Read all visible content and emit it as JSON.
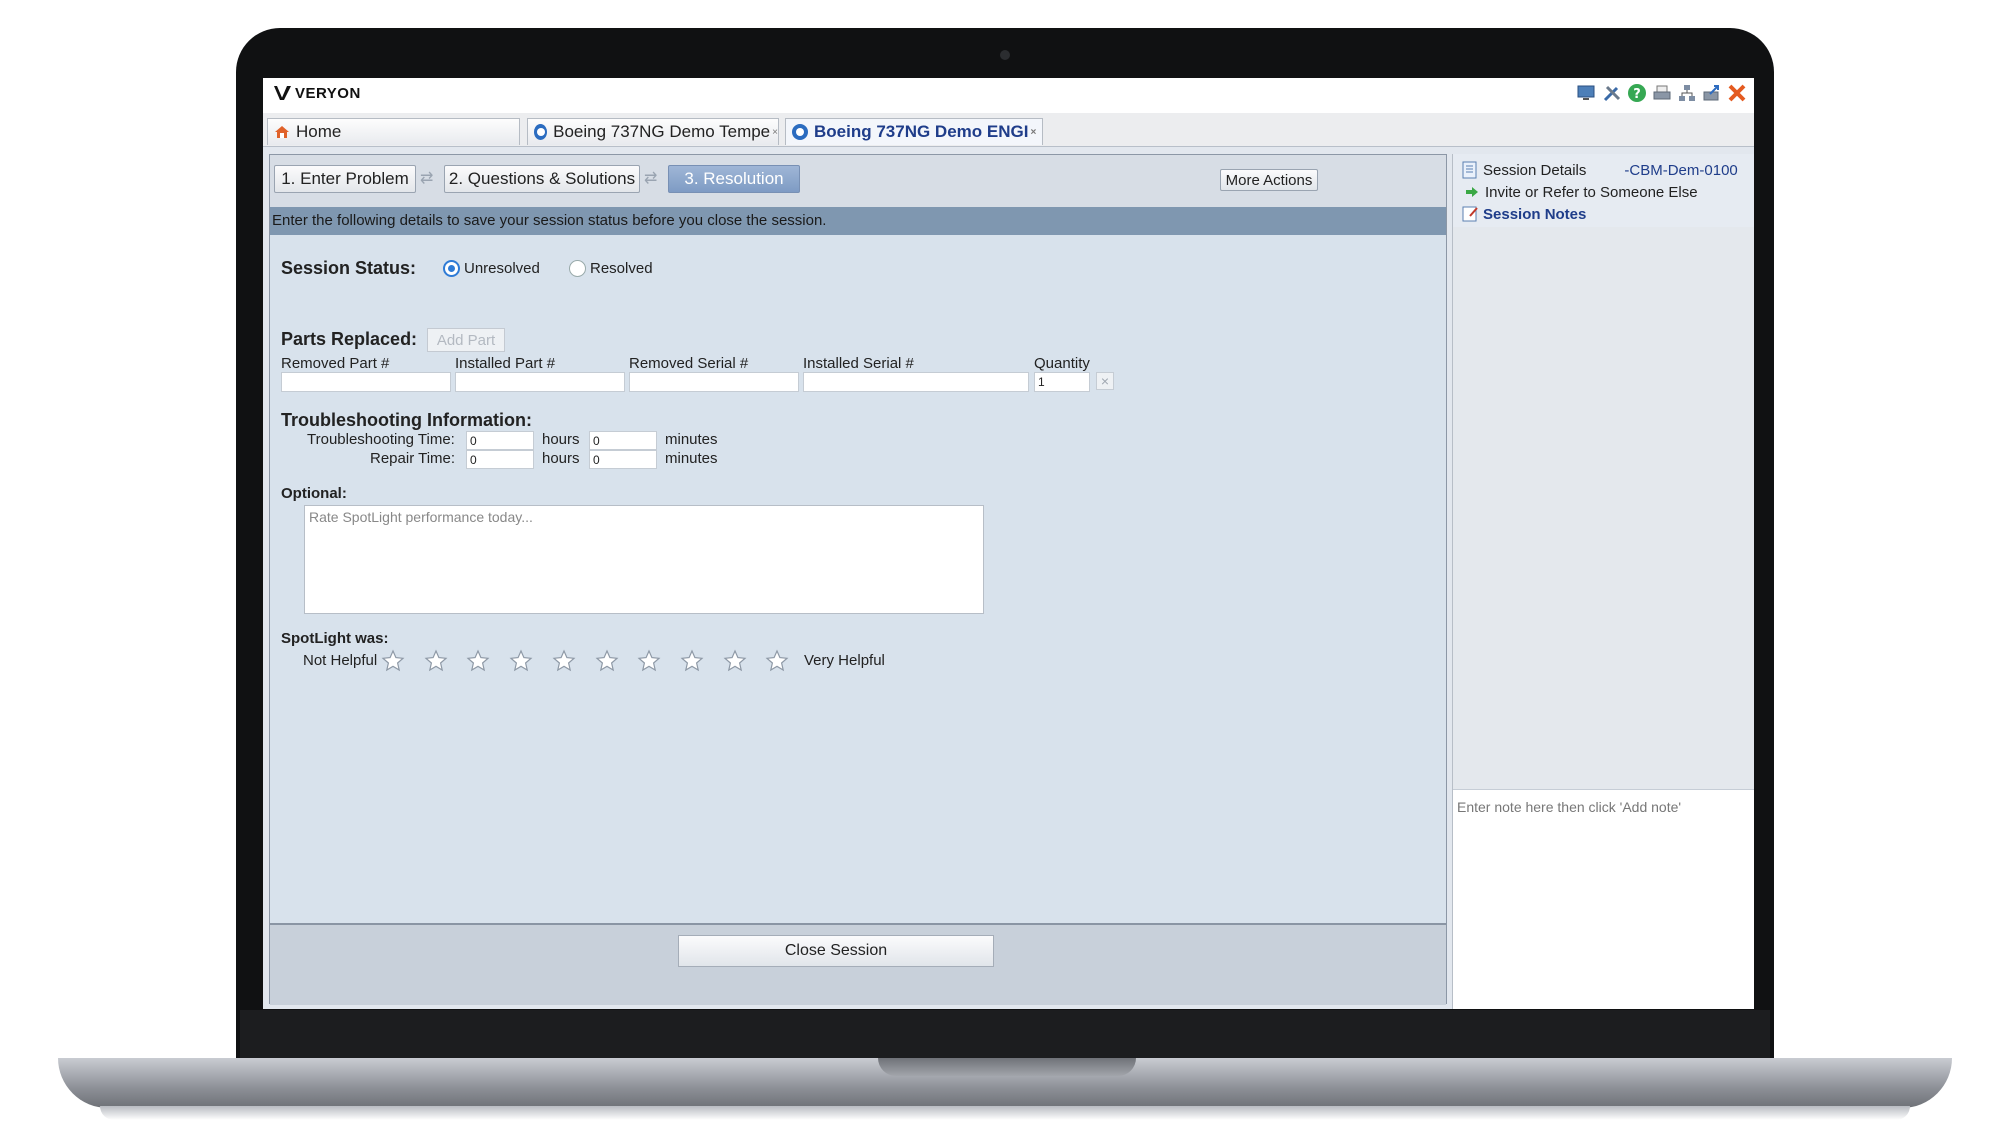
{
  "app": {
    "logo_text": "VERYON",
    "toolbar_icons": [
      "monitor-icon",
      "tools-icon",
      "help-icon",
      "print-icon",
      "network-icon",
      "export-icon",
      "close-app-icon"
    ]
  },
  "tabs": [
    {
      "label": "Home",
      "icon": "home-icon",
      "active": false
    },
    {
      "label": "Boeing 737NG Demo Tempe",
      "icon": "session-icon",
      "active": false
    },
    {
      "label": "Boeing 737NG Demo ENGI",
      "icon": "session-icon",
      "active": true
    }
  ],
  "steps": {
    "items": [
      "1. Enter Problem",
      "2. Questions & Solutions",
      "3. Resolution"
    ],
    "active_index": 2,
    "more_actions": "More Actions"
  },
  "info_text": "Enter the following details to save your session status before you close the session.",
  "session_status": {
    "label": "Session Status:",
    "options": [
      "Unresolved",
      "Resolved"
    ],
    "selected": "Unresolved"
  },
  "parts": {
    "label": "Parts Replaced:",
    "add_button": "Add Part",
    "columns": [
      "Removed Part #",
      "Installed Part #",
      "Removed Serial #",
      "Installed Serial #",
      "Quantity"
    ],
    "row": {
      "removed_part": "",
      "installed_part": "",
      "removed_serial": "",
      "installed_serial": "",
      "quantity": "1"
    }
  },
  "troubleshooting": {
    "label": "Troubleshooting Information:",
    "rows": [
      {
        "label": "Troubleshooting Time:",
        "hours": "0",
        "minutes": "0"
      },
      {
        "label": "Repair Time:",
        "hours": "0",
        "minutes": "0"
      }
    ],
    "hours_unit": "hours",
    "minutes_unit": "minutes"
  },
  "optional": {
    "label": "Optional:",
    "placeholder": "Rate SpotLight performance today..."
  },
  "rating": {
    "label": "SpotLight was:",
    "low_label": "Not Helpful",
    "high_label": "Very Helpful",
    "stars": 10,
    "value": 0
  },
  "footer": {
    "close_button": "Close Session"
  },
  "side": {
    "session_details": "Session Details",
    "session_id": "-CBM-Dem-0100",
    "invite": "Invite or Refer to Someone Else",
    "session_notes": "Session Notes",
    "note_placeholder": "Enter note here then click 'Add note'"
  },
  "colors": {
    "accent": "#2e7bd6",
    "active_step": "#8aa5cc",
    "info_bar": "#7f97b0",
    "form_bg": "#d8e2ec",
    "link_blue": "#1f3d8a"
  }
}
